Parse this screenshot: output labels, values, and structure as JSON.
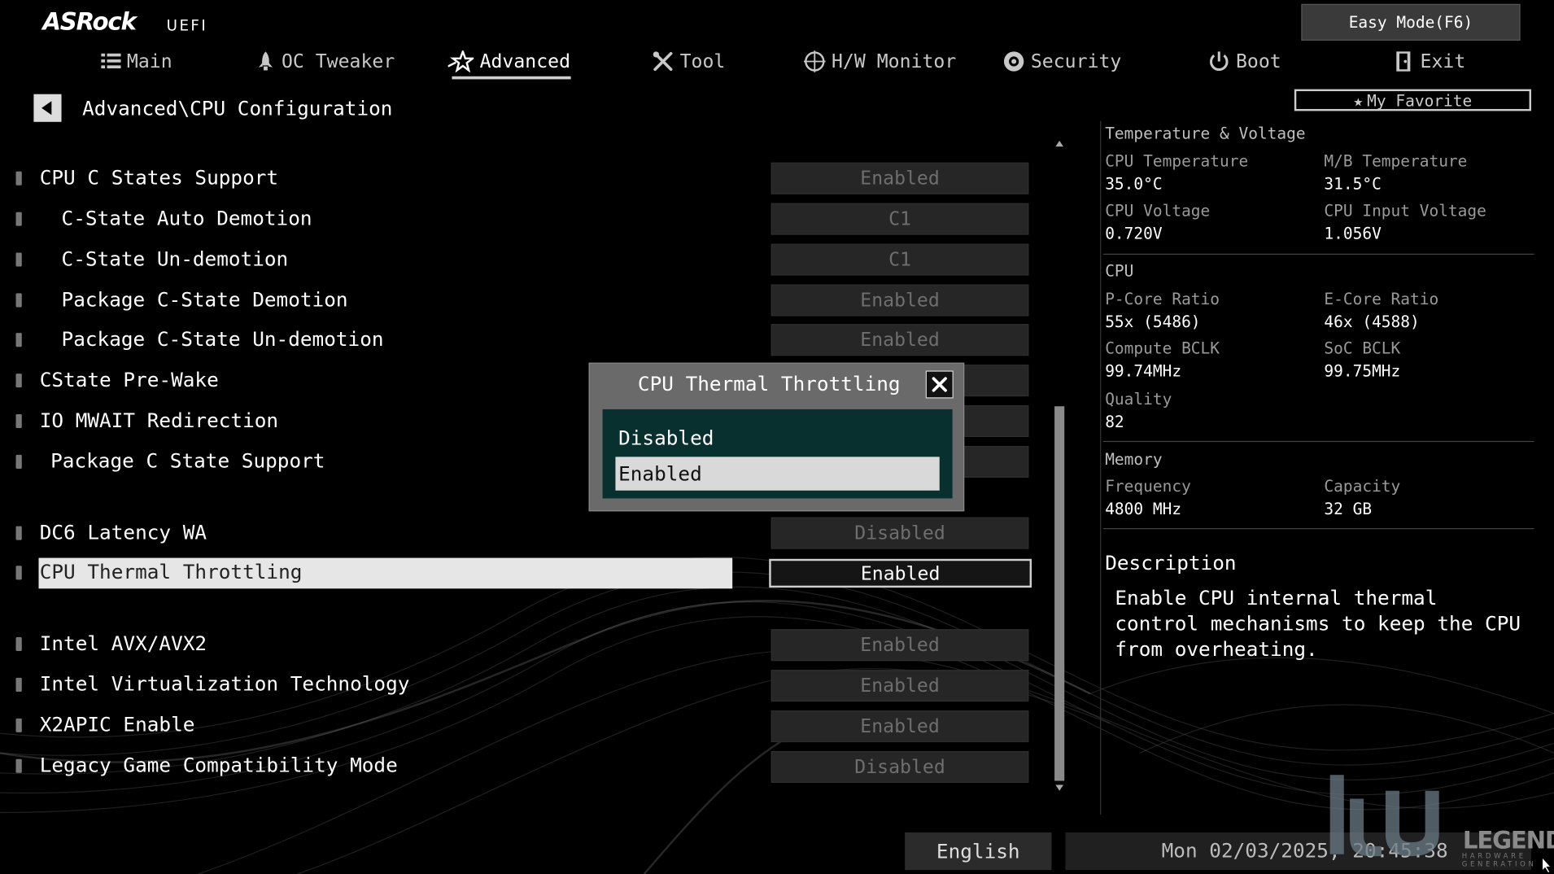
{
  "header": {
    "logo": "ASRock",
    "logo_sub": "UEFI",
    "easy_mode": "Easy Mode(F6)",
    "my_favorite": "My Favorite"
  },
  "tabs": [
    {
      "label": "Main",
      "icon": "list-icon"
    },
    {
      "label": "OC Tweaker",
      "icon": "rocket-icon"
    },
    {
      "label": "Advanced",
      "icon": "star-icon",
      "active": true
    },
    {
      "label": "Tool",
      "icon": "tools-icon"
    },
    {
      "label": "H/W Monitor",
      "icon": "monitor-icon"
    },
    {
      "label": "Security",
      "icon": "shield-icon"
    },
    {
      "label": "Boot",
      "icon": "power-icon"
    },
    {
      "label": "Exit",
      "icon": "exit-icon"
    }
  ],
  "breadcrumb": "Advanced\\CPU Configuration",
  "settings": [
    {
      "label": "CPU C States Support",
      "value": "Enabled"
    },
    {
      "label": "C-State Auto Demotion",
      "value": "C1"
    },
    {
      "label": "C-State Un-demotion",
      "value": "C1"
    },
    {
      "label": "Package C-State Demotion",
      "value": "Enabled"
    },
    {
      "label": "Package C-State Un-demotion",
      "value": "Enabled"
    },
    {
      "label": "CState Pre-Wake",
      "value": ""
    },
    {
      "label": "IO MWAIT Redirection",
      "value": ""
    },
    {
      "label": "Package C State Support",
      "value": ""
    },
    {
      "label": "DC6 Latency WA",
      "value": "Disabled"
    },
    {
      "label": "CPU Thermal Throttling",
      "value": "Enabled",
      "selected": true
    },
    {
      "label": "Intel AVX/AVX2",
      "value": "Enabled"
    },
    {
      "label": "Intel Virtualization Technology",
      "value": "Enabled"
    },
    {
      "label": "X2APIC Enable",
      "value": "Enabled"
    },
    {
      "label": "Legacy Game Compatibility Mode",
      "value": "Disabled"
    }
  ],
  "monitor": {
    "temp_voltage": {
      "title": "Temperature & Voltage",
      "cpu_temp_label": "CPU Temperature",
      "cpu_temp": "35.0°C",
      "mb_temp_label": "M/B Temperature",
      "mb_temp": "31.5°C",
      "cpu_volt_label": "CPU Voltage",
      "cpu_volt": "0.720V",
      "cpu_in_volt_label": "CPU Input Voltage",
      "cpu_in_volt": "1.056V"
    },
    "cpu": {
      "title": "CPU",
      "pcore_label": "P-Core Ratio",
      "pcore": "55x (5486)",
      "ecore_label": "E-Core Ratio",
      "ecore": "46x (4588)",
      "cbclk_label": "Compute BCLK",
      "cbclk": "99.74MHz",
      "socbclk_label": "SoC BCLK",
      "socbclk": "99.75MHz",
      "quality_label": "Quality",
      "quality": "82"
    },
    "memory": {
      "title": "Memory",
      "freq_label": "Frequency",
      "freq": "4800 MHz",
      "cap_label": "Capacity",
      "cap": "32 GB"
    }
  },
  "description": {
    "title": "Description",
    "text": "Enable CPU internal thermal control mechanisms to keep the CPU from overheating."
  },
  "popup": {
    "title": "CPU Thermal Throttling",
    "options": [
      "Disabled",
      "Enabled"
    ],
    "selected_index": 1
  },
  "footer": {
    "language": "English",
    "datetime": "Mon 02/03/2025, 20:45:38"
  },
  "watermark": {
    "text": "LEGEND",
    "sub": "HARDWARE GENERATION"
  }
}
